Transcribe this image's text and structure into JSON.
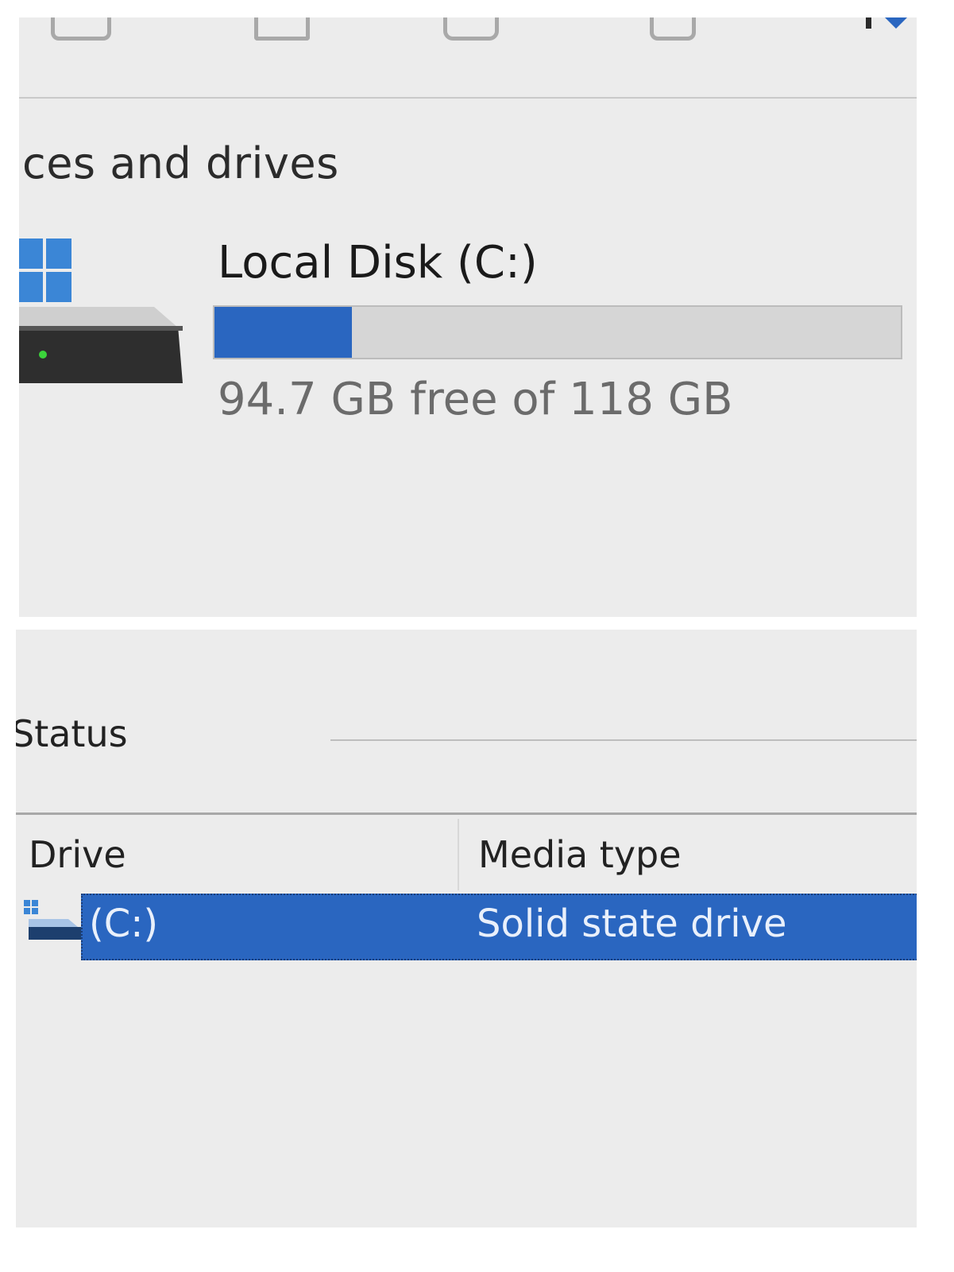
{
  "drives_section": {
    "title": "ces and drives",
    "drive": {
      "icon": "hard-drive-icon",
      "name": "Local Disk (C:)",
      "used_fraction": 0.2,
      "free_text": "94.7 GB free of 118 GB"
    }
  },
  "optimize_list": {
    "status_label": "Status",
    "columns": [
      "Drive",
      "Media type"
    ],
    "rows": [
      {
        "drive": "(C:)",
        "media_type": "Solid state drive",
        "selected": true
      }
    ]
  },
  "colors": {
    "accent": "#2a66c0",
    "usage_track": "#d6d6d6",
    "led_green": "#3bd43b"
  }
}
